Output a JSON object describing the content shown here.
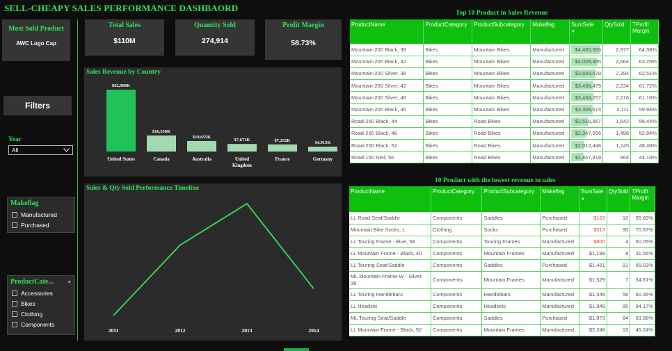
{
  "header": {
    "title": "SELL-CHEAPY SALES PERFORMANCE DASHBAORD"
  },
  "kpis": {
    "most_sold": {
      "label": "Most Sold Product",
      "value": "AWC Logo Cap"
    },
    "total_sales": {
      "label": "Total Sales",
      "value": "$110M"
    },
    "quantity_sold": {
      "label": "Quantity Sold",
      "value": "274,914"
    },
    "profit_margin": {
      "label": "Profit Margin",
      "value": "58.73%"
    }
  },
  "filters": {
    "title": "Filters",
    "year": {
      "label": "Year",
      "value": "All"
    },
    "makeflag": {
      "label": "Makeflag",
      "options": [
        "Manufactured",
        "Purchased"
      ]
    },
    "category": {
      "label": "ProductCate...",
      "options": [
        "Accessories",
        "Bikes",
        "Clothing",
        "Components"
      ]
    }
  },
  "colors": {
    "accent": "#2ee35a",
    "table_header": "#0fbf0f",
    "card": "#353535",
    "bar_main": "#21c25a",
    "bar_light": "#a3d9b1"
  },
  "chart_data": [
    {
      "type": "bar",
      "title": "Sales Revenue by Country",
      "categories": [
        "United States",
        "Canada",
        "Australia",
        "United Kingdom",
        "France",
        "Germany"
      ],
      "values": [
        62998,
        16356,
        10655,
        7671,
        7252,
        4915
      ],
      "value_labels": [
        "$62,998K",
        "$16,356K",
        "$10,655K",
        "$7,671K",
        "$7,252K",
        "$4,915K"
      ]
    },
    {
      "type": "line",
      "title": "Sales & Qty Sold Performance Timeline",
      "categories": [
        "2011",
        "2012",
        "2013",
        "2014"
      ],
      "values": [
        0.0,
        0.63,
        1.0,
        0.24
      ]
    }
  ],
  "top_table": {
    "title": "Top 10 Product in Sales Revenue",
    "columns": [
      "ProductName",
      "ProductCategory",
      "ProductSubcategory",
      "Makeflag",
      "SumSale",
      "QtySold",
      "TProfit Margin"
    ],
    "sort_icon": "caret-down-icon",
    "rows": [
      {
        "name": "Mountain-200 Black, 38",
        "cat": "Bikes",
        "sub": "Mountain Bikes",
        "flag": "Manufactured",
        "sale": "$4,400,593",
        "sale_num": 4400593,
        "qty": "2,977",
        "margin": "64.38%"
      },
      {
        "name": "Mountain-200 Black, 42",
        "cat": "Bikes",
        "sub": "Mountain Bikes",
        "flag": "Manufactured",
        "sale": "$4,009,495",
        "sale_num": 4009495,
        "qty": "2,664",
        "margin": "63.25%"
      },
      {
        "name": "Mountain-200 Silver, 38",
        "cat": "Bikes",
        "sub": "Mountain Bikes",
        "flag": "Manufactured",
        "sale": "$3,693,678",
        "sale_num": 3693678,
        "qty": "2,394",
        "margin": "62.51%"
      },
      {
        "name": "Mountain-200 Silver, 42",
        "cat": "Bikes",
        "sub": "Mountain Bikes",
        "flag": "Manufactured",
        "sale": "$3,438,479",
        "sale_num": 3438479,
        "qty": "2,234",
        "margin": "61.72%"
      },
      {
        "name": "Mountain-200 Silver, 46",
        "cat": "Bikes",
        "sub": "Mountain Bikes",
        "flag": "Manufactured",
        "sale": "$3,434,257",
        "sale_num": 3434257,
        "qty": "2,216",
        "margin": "61.16%"
      },
      {
        "name": "Mountain-200 Black, 46",
        "cat": "Bikes",
        "sub": "Mountain Bikes",
        "flag": "Manufactured",
        "sale": "$3,309,673",
        "sale_num": 3309673,
        "qty": "2,111",
        "margin": "59.94%"
      },
      {
        "name": "Road-250 Black, 44",
        "cat": "Bikes",
        "sub": "Road Bikes",
        "flag": "Manufactured",
        "sale": "$2,516,857",
        "sale_num": 2516857,
        "qty": "1,642",
        "margin": "56.44%"
      },
      {
        "name": "Road-250 Black, 48",
        "cat": "Bikes",
        "sub": "Road Bikes",
        "flag": "Manufactured",
        "sale": "$2,347,656",
        "sale_num": 2347656,
        "qty": "1,498",
        "margin": "52.84%"
      },
      {
        "name": "Road-250 Black, 52",
        "cat": "Bikes",
        "sub": "Road Bikes",
        "flag": "Manufactured",
        "sale": "$2,012,448",
        "sale_num": 2012448,
        "qty": "1,245",
        "margin": "48.46%"
      },
      {
        "name": "Road-150 Red, 56",
        "cat": "Bikes",
        "sub": "Road Bikes",
        "flag": "Manufactured",
        "sale": "$1,847,819",
        "sale_num": 1847819,
        "qty": "664",
        "margin": "44.18%"
      }
    ]
  },
  "low_table": {
    "title": "10 Product with the lowest revenue in sales",
    "columns": [
      "ProductName",
      "ProductCategory",
      "ProductSubcategory",
      "Makeflag",
      "SumSale",
      "QtySold",
      "TProfit Margin"
    ],
    "sort_icon": "caret-up-icon",
    "rows": [
      {
        "name": "LL Road Seat/Saddle",
        "cat": "Components",
        "sub": "Saddles",
        "flag": "Purchased",
        "sale": "$163",
        "qty": "10",
        "margin": "55.60%",
        "red": true
      },
      {
        "name": "Mountain Bike Socks, L",
        "cat": "Clothing",
        "sub": "Socks",
        "flag": "Purchased",
        "sale": "$513",
        "qty": "90",
        "margin": "70.87%",
        "red": true
      },
      {
        "name": "LL Touring Frame - Blue, 58",
        "cat": "Components",
        "sub": "Touring Frames",
        "flag": "Manufactured",
        "sale": "$800",
        "qty": "4",
        "margin": "50.05%",
        "red": true
      },
      {
        "name": "LL Mountain Frame - Black, 40",
        "cat": "Components",
        "sub": "Mountain Frames",
        "flag": "Manufactured",
        "sale": "$1,199",
        "qty": "8",
        "margin": "31.55%",
        "red": false
      },
      {
        "name": "LL Touring Seat/Saddle",
        "cat": "Components",
        "sub": "Saddles",
        "flag": "Purchased",
        "sale": "$1,481",
        "qty": "91",
        "margin": "65.03%",
        "red": false
      },
      {
        "name": "ML Mountain Frame-W - Silver, 38",
        "cat": "Components",
        "sub": "Mountain Frames",
        "flag": "Manufactured",
        "sale": "$1,529",
        "qty": "7",
        "margin": "34.81%",
        "red": false
      },
      {
        "name": "LL Touring Handlebars",
        "cat": "Components",
        "sub": "Handlebars",
        "flag": "Manufactured",
        "sale": "$1,549",
        "qty": "56",
        "margin": "60.36%",
        "red": false
      },
      {
        "name": "LL Headset",
        "cat": "Components",
        "sub": "Headsets",
        "flag": "Manufactured",
        "sale": "$1,949",
        "qty": "95",
        "margin": "64.17%",
        "red": false
      },
      {
        "name": "ML Touring Seat/Saddle",
        "cat": "Components",
        "sub": "Saddles",
        "flag": "Purchased",
        "sale": "$1,973",
        "qty": "84",
        "margin": "63.88%",
        "red": false
      },
      {
        "name": "LL Mountain Frame - Black, 52",
        "cat": "Components",
        "sub": "Mountain Frames",
        "flag": "Manufactured",
        "sale": "$2,248",
        "qty": "15",
        "margin": "45.24%",
        "red": false
      }
    ]
  }
}
